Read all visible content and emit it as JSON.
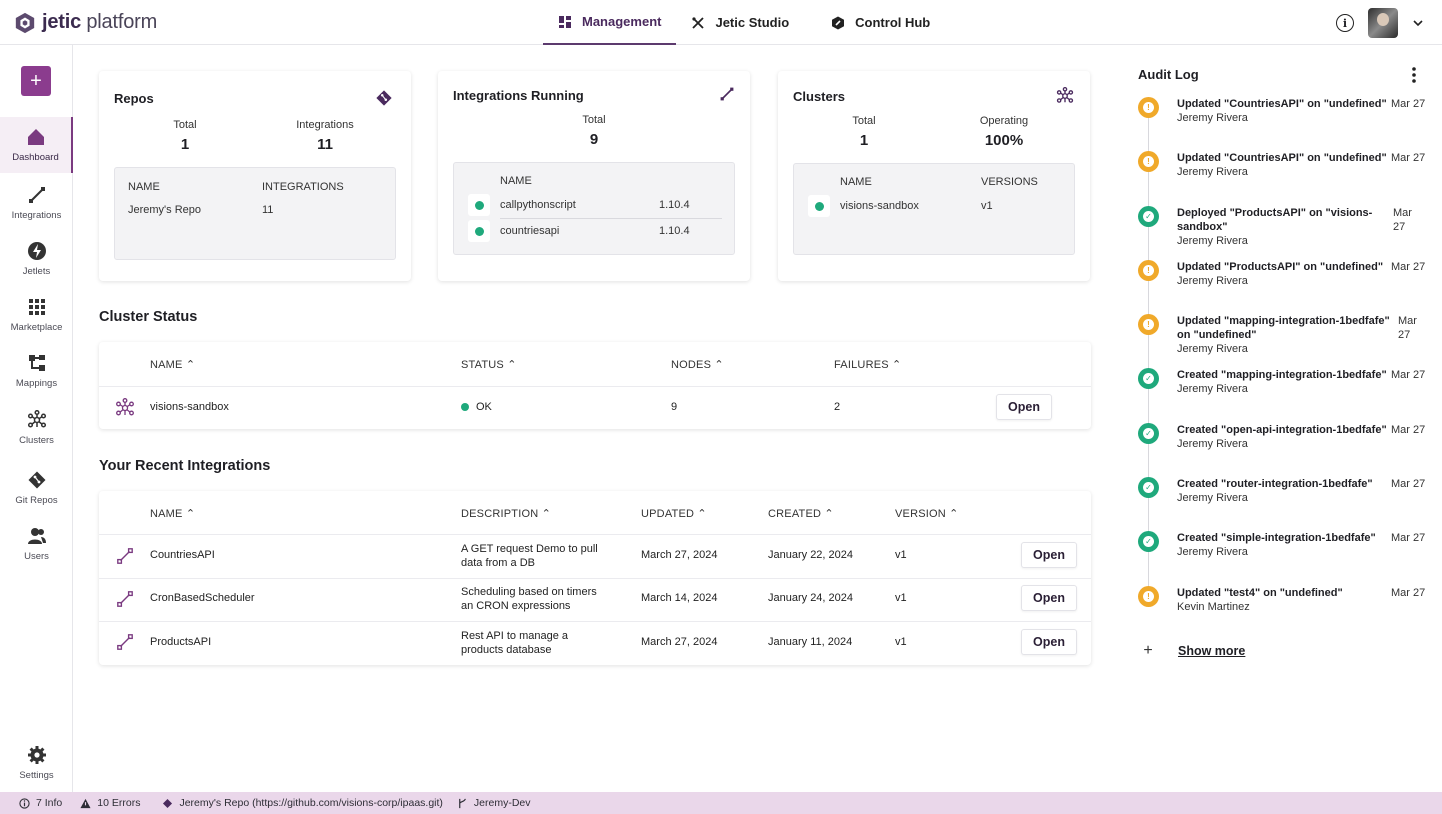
{
  "app": {
    "logo_bold": "jetic",
    "logo_rest": " platform"
  },
  "nav": {
    "tabs": [
      {
        "label": "Management",
        "icon": "grid-icon"
      },
      {
        "label": "Jetic Studio",
        "icon": "tools-icon"
      },
      {
        "label": "Control Hub",
        "icon": "hub-icon"
      }
    ]
  },
  "sidebar": {
    "add_label": "+",
    "items": [
      {
        "label": "Dashboard",
        "icon": "home-icon"
      },
      {
        "label": "Integrations",
        "icon": "integration-icon"
      },
      {
        "label": "Jetlets",
        "icon": "bolt-icon"
      },
      {
        "label": "Marketplace",
        "icon": "apps-icon"
      },
      {
        "label": "Mappings",
        "icon": "mapping-icon"
      },
      {
        "label": "Clusters",
        "icon": "cluster-icon"
      },
      {
        "label": "Git Repos",
        "icon": "git-icon"
      },
      {
        "label": "Users",
        "icon": "users-icon"
      }
    ],
    "settings_label": "Settings"
  },
  "repos": {
    "title": "Repos",
    "total_label": "Total",
    "total_value": "1",
    "integrations_label": "Integrations",
    "integrations_value": "11",
    "col_name": "NAME",
    "col_integrations": "INTEGRATIONS",
    "rows": [
      {
        "name": "Jeremy's Repo",
        "integrations": "11"
      }
    ]
  },
  "integrations_running": {
    "title": "Integrations Running",
    "total_label": "Total",
    "total_value": "9",
    "col_name": "NAME",
    "rows": [
      {
        "name": "callpythonscript",
        "version": "1.10.4"
      },
      {
        "name": "countriesapi",
        "version": "1.10.4"
      }
    ]
  },
  "clusters_card": {
    "title": "Clusters",
    "total_label": "Total",
    "total_value": "1",
    "operating_label": "Operating",
    "operating_value": "100%",
    "col_name": "NAME",
    "col_versions": "VERSIONS",
    "rows": [
      {
        "name": "visions-sandbox",
        "version": "v1"
      }
    ]
  },
  "cluster_status": {
    "title": "Cluster Status",
    "headers": [
      "NAME",
      "STATUS",
      "NODES",
      "FAILURES"
    ],
    "rows": [
      {
        "name": "visions-sandbox",
        "status": "OK",
        "nodes": "9",
        "failures": "2",
        "action": "Open"
      }
    ]
  },
  "recent_integrations": {
    "title": "Your Recent Integrations",
    "headers": [
      "NAME",
      "DESCRIPTION",
      "UPDATED",
      "CREATED",
      "VERSION"
    ],
    "rows": [
      {
        "name": "CountriesAPI",
        "desc1": "A GET request Demo to pull",
        "desc2": "data from a DB",
        "updated": "March 27, 2024",
        "created": "January 22, 2024",
        "version": "v1",
        "action": "Open"
      },
      {
        "name": "CronBasedScheduler",
        "desc1": "Scheduling based on timers",
        "desc2": "an CRON expressions",
        "updated": "March 14, 2024",
        "created": "January 24, 2024",
        "version": "v1",
        "action": "Open"
      },
      {
        "name": "ProductsAPI",
        "desc1": "Rest API to manage a",
        "desc2": "products database",
        "updated": "March 27, 2024",
        "created": "January 11, 2024",
        "version": "v1",
        "action": "Open"
      }
    ]
  },
  "audit_log": {
    "title": "Audit Log",
    "items": [
      {
        "type": "warn",
        "text": "Updated \"CountriesAPI\" on \"undefined\"",
        "user": "Jeremy Rivera",
        "date": "Mar 27"
      },
      {
        "type": "warn",
        "text": "Updated \"CountriesAPI\" on \"undefined\"",
        "user": "Jeremy Rivera",
        "date": "Mar 27"
      },
      {
        "type": "ok",
        "text": "Deployed \"ProductsAPI\" on \"visions-sandbox\"",
        "user": "Jeremy Rivera",
        "date": "Mar 27"
      },
      {
        "type": "warn",
        "text": "Updated \"ProductsAPI\" on \"undefined\"",
        "user": "Jeremy Rivera",
        "date": "Mar 27"
      },
      {
        "type": "warn",
        "text": "Updated \"mapping-integration-1bedfafe\" on \"undefined\"",
        "user": "Jeremy Rivera",
        "date": "Mar 27"
      },
      {
        "type": "ok",
        "text": "Created \"mapping-integration-1bedfafe\"",
        "user": "Jeremy Rivera",
        "date": "Mar 27"
      },
      {
        "type": "ok",
        "text": "Created \"open-api-integration-1bedfafe\"",
        "user": "Jeremy Rivera",
        "date": "Mar 27"
      },
      {
        "type": "ok",
        "text": "Created \"router-integration-1bedfafe\"",
        "user": "Jeremy Rivera",
        "date": "Mar 27"
      },
      {
        "type": "ok",
        "text": "Created \"simple-integration-1bedfafe\"",
        "user": "Jeremy Rivera",
        "date": "Mar 27"
      },
      {
        "type": "warn",
        "text": "Updated \"test4\" on \"undefined\"",
        "user": "Kevin Martinez",
        "date": "Mar 27"
      }
    ],
    "show_more": "Show more"
  },
  "statusbar": {
    "info": "7 Info",
    "errors": "10 Errors",
    "repo": "Jeremy's Repo (https://github.com/visions-corp/ipaas.git)",
    "branch": "Jeremy-Dev"
  },
  "colors": {
    "accent": "#8b3c8e",
    "brand_dark": "#3b2b4f",
    "ok": "#1fa97c",
    "warn": "#f0a92a",
    "statusbar": "#ead7ea"
  }
}
